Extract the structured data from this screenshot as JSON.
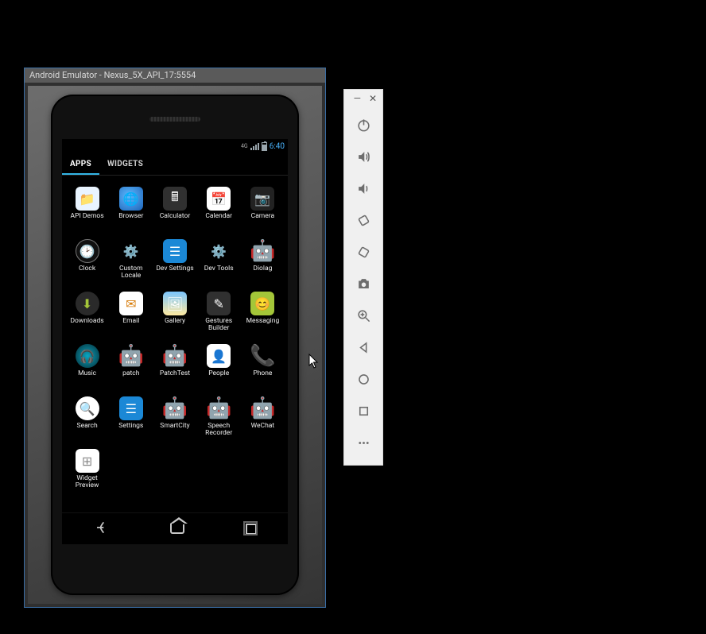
{
  "window": {
    "title": "Android Emulator - Nexus_5X_API_17:5554"
  },
  "statusbar": {
    "net": "4G",
    "signalAlt": "H",
    "time": "6:40"
  },
  "tabs": {
    "apps": "APPS",
    "widgets": "WIDGETS"
  },
  "apps": [
    {
      "name": "API Demos",
      "icon": "folder",
      "cls": "bg-folder",
      "glyph": "📁"
    },
    {
      "name": "Browser",
      "icon": "globe",
      "cls": "bg-globe",
      "glyph": "🌐"
    },
    {
      "name": "Calculator",
      "icon": "calc",
      "cls": "bg-dark",
      "glyph": "🖩"
    },
    {
      "name": "Calendar",
      "icon": "calendar",
      "cls": "bg-cal",
      "glyph": "📅"
    },
    {
      "name": "Camera",
      "icon": "camera",
      "cls": "bg-cam",
      "glyph": "📷"
    },
    {
      "name": "Clock",
      "icon": "clock",
      "cls": "bg-clock",
      "glyph": "🕑"
    },
    {
      "name": "Custom Locale",
      "icon": "gear",
      "cls": "bg-gear",
      "glyph": "⚙️"
    },
    {
      "name": "Dev Settings",
      "icon": "sliders",
      "cls": "bg-blue",
      "glyph": "☰"
    },
    {
      "name": "Dev Tools",
      "icon": "gear",
      "cls": "bg-gear",
      "glyph": "⚙️"
    },
    {
      "name": "Diolag",
      "icon": "android",
      "cls": "bg-android",
      "glyph": "🤖"
    },
    {
      "name": "Downloads",
      "icon": "download",
      "cls": "bg-dl",
      "glyph": "⬇"
    },
    {
      "name": "Email",
      "icon": "mail",
      "cls": "bg-mail",
      "glyph": "✉"
    },
    {
      "name": "Gallery",
      "icon": "gallery",
      "cls": "bg-gal",
      "glyph": "🖼"
    },
    {
      "name": "Gestures Builder",
      "icon": "gesture",
      "cls": "bg-dark",
      "glyph": "✎"
    },
    {
      "name": "Messaging",
      "icon": "msg",
      "cls": "bg-msg",
      "glyph": "😊"
    },
    {
      "name": "Music",
      "icon": "music",
      "cls": "bg-music",
      "glyph": "🎧"
    },
    {
      "name": "patch",
      "icon": "android",
      "cls": "bg-android",
      "glyph": "🤖"
    },
    {
      "name": "PatchTest",
      "icon": "android",
      "cls": "bg-android",
      "glyph": "🤖"
    },
    {
      "name": "People",
      "icon": "people",
      "cls": "bg-people",
      "glyph": "👤"
    },
    {
      "name": "Phone",
      "icon": "phone",
      "cls": "bg-phone",
      "glyph": "📞"
    },
    {
      "name": "Search",
      "icon": "search",
      "cls": "bg-search",
      "glyph": "🔍"
    },
    {
      "name": "Settings",
      "icon": "sliders",
      "cls": "bg-blue",
      "glyph": "☰"
    },
    {
      "name": "SmartCity",
      "icon": "android",
      "cls": "bg-android",
      "glyph": "🤖"
    },
    {
      "name": "Speech Recorder",
      "icon": "android",
      "cls": "bg-android",
      "glyph": "🤖"
    },
    {
      "name": "WeChat",
      "icon": "android",
      "cls": "bg-android",
      "glyph": "🤖"
    },
    {
      "name": "Widget Preview",
      "icon": "widget",
      "cls": "bg-widget",
      "glyph": "⊞"
    }
  ],
  "navbar": {
    "back": "Back",
    "home": "Home",
    "recent": "Recent apps"
  },
  "toolbar": {
    "minimize": "Minimize",
    "close": "Close",
    "power": "Power",
    "vol_up": "Volume up",
    "vol_down": "Volume down",
    "rotate_left": "Rotate left",
    "rotate_right": "Rotate right",
    "screenshot": "Take screenshot",
    "zoom": "Zoom",
    "back": "Back",
    "home": "Home",
    "overview": "Overview",
    "more": "More"
  }
}
